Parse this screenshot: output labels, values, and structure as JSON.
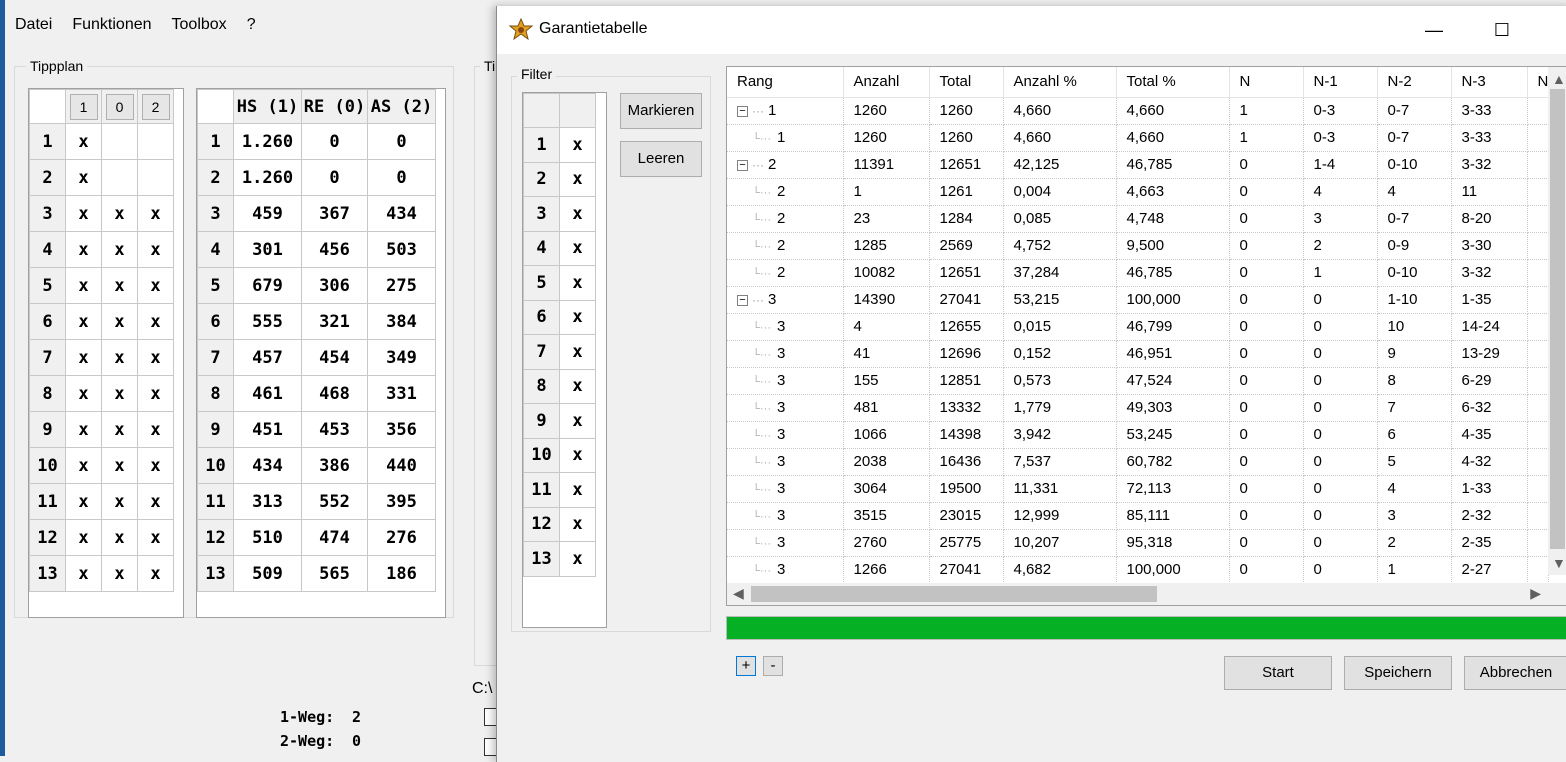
{
  "main_window": {
    "menu": [
      "Datei",
      "Funktionen",
      "Toolbox",
      "?"
    ],
    "tippplan": {
      "title": "Tippplan",
      "headers": [
        "1",
        "0",
        "2"
      ],
      "rows": [
        {
          "n": "1",
          "c": [
            "x",
            "",
            ""
          ]
        },
        {
          "n": "2",
          "c": [
            "x",
            "",
            ""
          ]
        },
        {
          "n": "3",
          "c": [
            "x",
            "x",
            "x"
          ]
        },
        {
          "n": "4",
          "c": [
            "x",
            "x",
            "x"
          ]
        },
        {
          "n": "5",
          "c": [
            "x",
            "x",
            "x"
          ]
        },
        {
          "n": "6",
          "c": [
            "x",
            "x",
            "x"
          ]
        },
        {
          "n": "7",
          "c": [
            "x",
            "x",
            "x"
          ]
        },
        {
          "n": "8",
          "c": [
            "x",
            "x",
            "x"
          ]
        },
        {
          "n": "9",
          "c": [
            "x",
            "x",
            "x"
          ]
        },
        {
          "n": "10",
          "c": [
            "x",
            "x",
            "x"
          ]
        },
        {
          "n": "11",
          "c": [
            "x",
            "x",
            "x"
          ]
        },
        {
          "n": "12",
          "c": [
            "x",
            "x",
            "x"
          ]
        },
        {
          "n": "13",
          "c": [
            "x",
            "x",
            "x"
          ]
        }
      ]
    },
    "stats": {
      "headers": [
        "HS (1)",
        "RE (0)",
        "AS (2)"
      ],
      "rows": [
        {
          "n": "1",
          "c": [
            "1.260",
            "0",
            "0"
          ]
        },
        {
          "n": "2",
          "c": [
            "1.260",
            "0",
            "0"
          ]
        },
        {
          "n": "3",
          "c": [
            "459",
            "367",
            "434"
          ]
        },
        {
          "n": "4",
          "c": [
            "301",
            "456",
            "503"
          ]
        },
        {
          "n": "5",
          "c": [
            "679",
            "306",
            "275"
          ]
        },
        {
          "n": "6",
          "c": [
            "555",
            "321",
            "384"
          ]
        },
        {
          "n": "7",
          "c": [
            "457",
            "454",
            "349"
          ]
        },
        {
          "n": "8",
          "c": [
            "461",
            "468",
            "331"
          ]
        },
        {
          "n": "9",
          "c": [
            "451",
            "453",
            "356"
          ]
        },
        {
          "n": "10",
          "c": [
            "434",
            "386",
            "440"
          ]
        },
        {
          "n": "11",
          "c": [
            "313",
            "552",
            "395"
          ]
        },
        {
          "n": "12",
          "c": [
            "510",
            "474",
            "276"
          ]
        },
        {
          "n": "13",
          "c": [
            "509",
            "565",
            "186"
          ]
        }
      ]
    },
    "partial_group_title": "Ti",
    "path_fragment": "C:\\",
    "weg1_label": "1-Weg:",
    "weg1_value": "2",
    "weg2_label": "2-Weg:",
    "weg2_value": "0"
  },
  "dialog": {
    "title": "Garantietabelle",
    "icon": "star-settings-icon",
    "filter": {
      "title": "Filter",
      "rows": [
        {
          "n": "1",
          "v": "x"
        },
        {
          "n": "2",
          "v": "x"
        },
        {
          "n": "3",
          "v": "x"
        },
        {
          "n": "4",
          "v": "x"
        },
        {
          "n": "5",
          "v": "x"
        },
        {
          "n": "6",
          "v": "x"
        },
        {
          "n": "7",
          "v": "x"
        },
        {
          "n": "8",
          "v": "x"
        },
        {
          "n": "9",
          "v": "x"
        },
        {
          "n": "10",
          "v": "x"
        },
        {
          "n": "11",
          "v": "x"
        },
        {
          "n": "12",
          "v": "x"
        },
        {
          "n": "13",
          "v": "x"
        }
      ]
    },
    "markieren_label": "Markieren",
    "leeren_label": "Leeren",
    "table": {
      "columns": [
        "Rang",
        "Anzahl",
        "Total",
        "Anzahl %",
        "Total %",
        "N",
        "N-1",
        "N-2",
        "N-3",
        "N"
      ],
      "rows": [
        {
          "level": 0,
          "expander": "−",
          "c": [
            "1",
            "1260",
            "1260",
            "4,660",
            "4,660",
            "1",
            "0-3",
            "0-7",
            "3-33"
          ]
        },
        {
          "level": 1,
          "c": [
            "1",
            "1260",
            "1260",
            "4,660",
            "4,660",
            "1",
            "0-3",
            "0-7",
            "3-33"
          ]
        },
        {
          "level": 0,
          "expander": "−",
          "c": [
            "2",
            "11391",
            "12651",
            "42,125",
            "46,785",
            "0",
            "1-4",
            "0-10",
            "3-32"
          ]
        },
        {
          "level": 1,
          "c": [
            "2",
            "1",
            "1261",
            "0,004",
            "4,663",
            "0",
            "4",
            "4",
            "11"
          ]
        },
        {
          "level": 1,
          "c": [
            "2",
            "23",
            "1284",
            "0,085",
            "4,748",
            "0",
            "3",
            "0-7",
            "8-20"
          ]
        },
        {
          "level": 1,
          "c": [
            "2",
            "1285",
            "2569",
            "4,752",
            "9,500",
            "0",
            "2",
            "0-9",
            "3-30"
          ]
        },
        {
          "level": 1,
          "c": [
            "2",
            "10082",
            "12651",
            "37,284",
            "46,785",
            "0",
            "1",
            "0-10",
            "3-32"
          ]
        },
        {
          "level": 0,
          "expander": "−",
          "c": [
            "3",
            "14390",
            "27041",
            "53,215",
            "100,000",
            "0",
            "0",
            "1-10",
            "1-35"
          ]
        },
        {
          "level": 1,
          "c": [
            "3",
            "4",
            "12655",
            "0,015",
            "46,799",
            "0",
            "0",
            "10",
            "14-24"
          ]
        },
        {
          "level": 1,
          "c": [
            "3",
            "41",
            "12696",
            "0,152",
            "46,951",
            "0",
            "0",
            "9",
            "13-29"
          ]
        },
        {
          "level": 1,
          "c": [
            "3",
            "155",
            "12851",
            "0,573",
            "47,524",
            "0",
            "0",
            "8",
            "6-29"
          ]
        },
        {
          "level": 1,
          "c": [
            "3",
            "481",
            "13332",
            "1,779",
            "49,303",
            "0",
            "0",
            "7",
            "6-32"
          ]
        },
        {
          "level": 1,
          "c": [
            "3",
            "1066",
            "14398",
            "3,942",
            "53,245",
            "0",
            "0",
            "6",
            "4-35"
          ]
        },
        {
          "level": 1,
          "c": [
            "3",
            "2038",
            "16436",
            "7,537",
            "60,782",
            "0",
            "0",
            "5",
            "4-32"
          ]
        },
        {
          "level": 1,
          "c": [
            "3",
            "3064",
            "19500",
            "11,331",
            "72,113",
            "0",
            "0",
            "4",
            "1-33"
          ]
        },
        {
          "level": 1,
          "c": [
            "3",
            "3515",
            "23015",
            "12,999",
            "85,111",
            "0",
            "0",
            "3",
            "2-32"
          ]
        },
        {
          "level": 1,
          "c": [
            "3",
            "2760",
            "25775",
            "10,207",
            "95,318",
            "0",
            "0",
            "2",
            "2-35"
          ]
        },
        {
          "level": 1,
          "c": [
            "3",
            "1266",
            "27041",
            "4,682",
            "100,000",
            "0",
            "0",
            "1",
            "2-27"
          ]
        }
      ]
    },
    "progress_fraction": 1.0,
    "progress_color": "#06b025",
    "expand_all_label": "+",
    "collapse_all_label": "-",
    "start_label": "Start",
    "speichern_label": "Speichern",
    "abbrechen_label": "Abbrechen",
    "window_buttons": {
      "minimize": "—",
      "maximize": "☐"
    }
  }
}
